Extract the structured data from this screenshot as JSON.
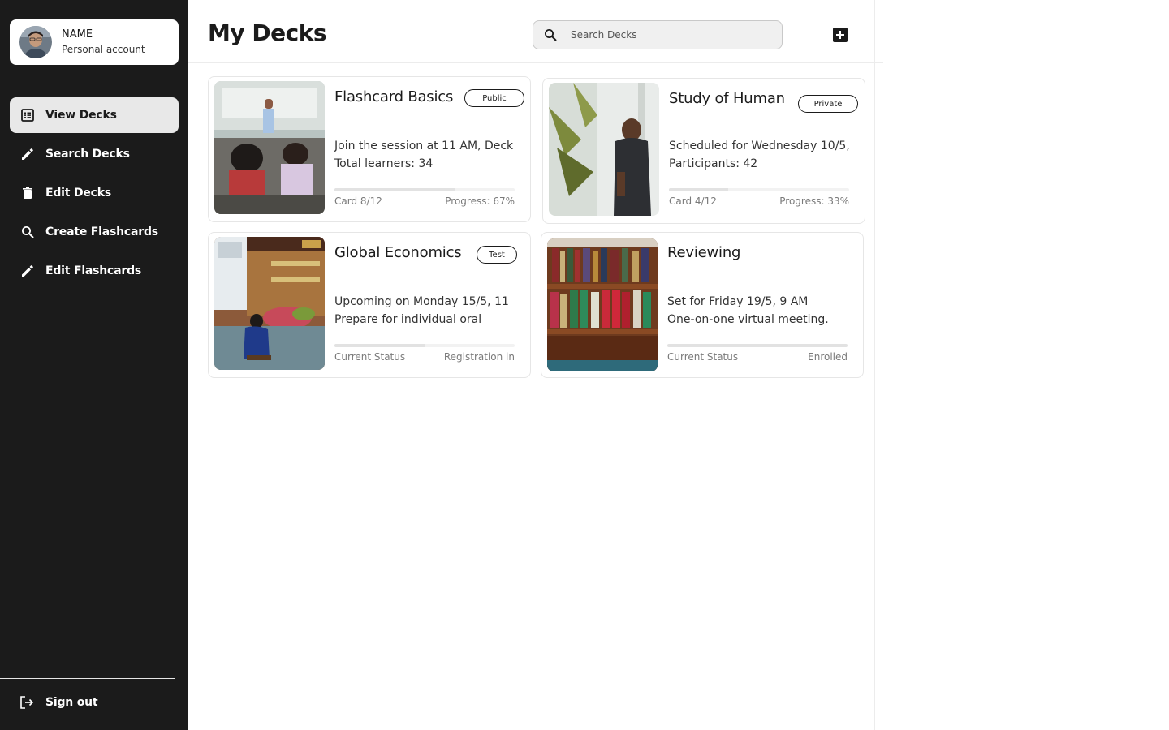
{
  "account": {
    "name": "NAME",
    "type": "Personal account"
  },
  "nav": {
    "items": [
      {
        "label": "View Decks",
        "icon": "list-icon",
        "active": true
      },
      {
        "label": "Search Decks",
        "icon": "pencil-icon"
      },
      {
        "label": "Edit Decks",
        "icon": "trash-icon"
      },
      {
        "label": "Create Flashcards",
        "icon": "search-icon"
      },
      {
        "label": "Edit Flashcards",
        "icon": "pencil-icon"
      }
    ],
    "signout": "Sign out"
  },
  "header": {
    "title": "My Decks",
    "search_placeholder": "Search Decks"
  },
  "decks": [
    {
      "title": "Flashcard Basics",
      "badge": "Public",
      "line1": "Join the session at 11 AM, Deck",
      "line2": "Total learners: 34",
      "meta_left": "Card 8/12",
      "meta_right": "Progress: 67%",
      "progress": 0.67,
      "image": "classroom photo"
    },
    {
      "title": "Study of Human",
      "badge": "Private",
      "line1": "Scheduled for Wednesday 10/5,",
      "line2": "Participants: 42",
      "meta_left": "Card 4/12",
      "meta_right": "Progress: 33%",
      "progress": 0.33,
      "image": "man at window photo"
    },
    {
      "title": "Global Economics",
      "badge": "Test",
      "line1": "Upcoming on Monday 15/5, 11",
      "line2": "Prepare for individual oral",
      "meta_left": "Current Status",
      "meta_right": "Registration in",
      "progress": 0.5,
      "image": "market shop photo"
    },
    {
      "title": "Reviewing",
      "badge": "",
      "line1": "Set for Friday 19/5, 9 AM",
      "line2": "One-on-one virtual meeting.",
      "meta_left": "Current Status",
      "meta_right": "Enrolled",
      "progress": 1.0,
      "image": "bookshelf photo"
    }
  ],
  "colors": {
    "sidebar": "#1b1b1b",
    "active_nav": "#e8e8e8",
    "page_bg": "#ffffff"
  }
}
